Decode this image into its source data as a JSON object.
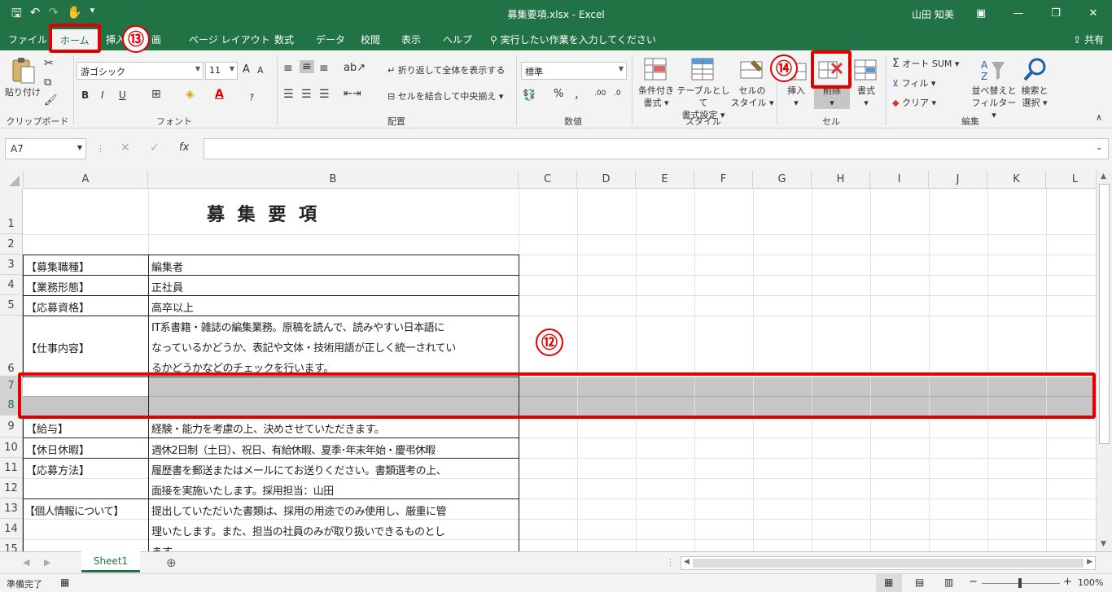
{
  "window": {
    "title": "募集要項.xlsx  -  Excel",
    "user": "山田 知美",
    "qat_icons": [
      "save-icon",
      "undo-icon",
      "redo-icon",
      "touch-icon",
      "customize-icon"
    ]
  },
  "tabs": [
    "ファイル",
    "ホーム",
    "挿入",
    "画",
    "ページ レイアウト",
    "数式",
    "データ",
    "校閲",
    "表示",
    "ヘルプ"
  ],
  "active_tab": "ホーム",
  "tell_me": "実行したい作業を入力してください",
  "share": "共有",
  "ribbon": {
    "clipboard": {
      "paste": "貼り付け",
      "label": "クリップボード"
    },
    "font": {
      "name": "游ゴシック",
      "size": "11",
      "bold": "B",
      "italic": "I",
      "underline": "U",
      "grow": "A",
      "shrink": "A",
      "label": "フォント"
    },
    "alignment": {
      "wrap": "折り返して全体を表示する",
      "merge": "セルを結合して中央揃え",
      "label": "配置"
    },
    "number": {
      "format": "標準",
      "percent": "%",
      "comma": ",",
      "label": "数値"
    },
    "styles": {
      "conditional": "条件付き",
      "conditional2": "書式",
      "table": "テーブルとして",
      "table2": "書式設定",
      "cell": "セルの",
      "cell2": "スタイル",
      "label": "スタイル"
    },
    "cells": {
      "insert": "挿入",
      "delete": "削除",
      "format": "書式",
      "label": "セル"
    },
    "editing": {
      "autosum": "オート SUM",
      "fill": "フィル",
      "clear": "クリア",
      "sort": "並べ替えと",
      "sort2": "フィルター",
      "find": "検索と",
      "find2": "選択",
      "label": "編集"
    }
  },
  "formula_bar": {
    "name_box": "A7",
    "fx": "fx",
    "value": ""
  },
  "columns": [
    "A",
    "B",
    "C",
    "D",
    "E",
    "F",
    "G",
    "H",
    "I",
    "J",
    "K",
    "L"
  ],
  "rows": [
    "1",
    "2",
    "3",
    "4",
    "5",
    "6",
    "7",
    "8",
    "9",
    "10",
    "11",
    "12",
    "13",
    "14",
    "15"
  ],
  "sheet": {
    "title": "募 集 要 項",
    "r3a": "【募集職種】",
    "r3b": "編集者",
    "r4a": "【業務形態】",
    "r4b": "正社員",
    "r5a": "【応募資格】",
    "r5b": "高卒以上",
    "r6a": "【仕事内容】",
    "r6b1": "IT系書籍・雑誌の編集業務。原稿を読んで、読みやすい日本語に",
    "r6b2": "なっているかどうか、表記や文体・技術用語が正しく統一されてい",
    "r6b3": "るかどうかなどのチェックを行います。",
    "r9a": "【給与】",
    "r9b": "経験・能力を考慮の上、決めさせていただきます。",
    "r10a": "【休日休暇】",
    "r10b": "週休2日制（土日）、祝日、有給休暇、夏季･年末年始・慶弔休暇",
    "r11a": "【応募方法】",
    "r11b": "履歴書を郵送またはメールにてお送りください。書類選考の上、",
    "r12b": "面接を実施いたします。採用担当：山田",
    "r13a": "【個人情報について】",
    "r13b": "提出していただいた書類は、採用の用途でのみ使用し、厳重に管",
    "r14b": "理いたします。また、担当の社員のみが取り扱いできるものとし",
    "r15b": "ます。"
  },
  "annotations": {
    "n12": "⑫",
    "n13": "⑬",
    "n14": "⑭"
  },
  "sheet_tab": "Sheet1",
  "status": {
    "ready": "準備完了",
    "zoom": "100%"
  }
}
